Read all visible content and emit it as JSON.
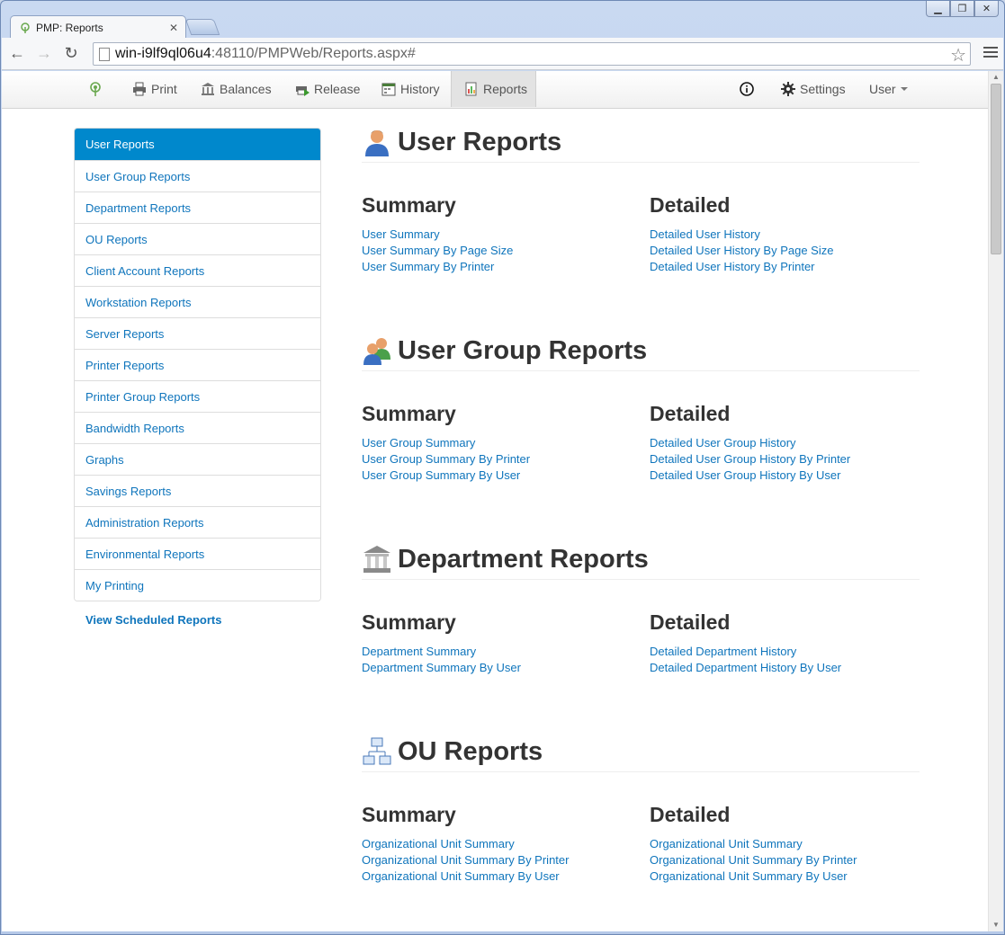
{
  "browser": {
    "tab_title": "PMP: Reports",
    "url_host": "win-i9lf9ql06u4",
    "url_path": ":48110/PMPWeb/Reports.aspx#"
  },
  "appnav": {
    "print": "Print",
    "balances": "Balances",
    "release": "Release",
    "history": "History",
    "reports": "Reports",
    "settings": "Settings",
    "user": "User"
  },
  "sidebar": {
    "items": [
      "User Reports",
      "User Group Reports",
      "Department Reports",
      "OU Reports",
      "Client Account Reports",
      "Workstation Reports",
      "Server Reports",
      "Printer Reports",
      "Printer Group Reports",
      "Bandwidth Reports",
      "Graphs",
      "Savings Reports",
      "Administration Reports",
      "Environmental Reports",
      "My Printing"
    ],
    "scheduled_link": "View Scheduled Reports"
  },
  "sections": [
    {
      "title": "User Reports",
      "icon": "user-icon",
      "summary_label": "Summary",
      "detailed_label": "Detailed",
      "summary": [
        "User Summary",
        "User Summary By Page Size",
        "User Summary By Printer"
      ],
      "detailed": [
        "Detailed User History",
        "Detailed User History By Page Size",
        "Detailed User History By Printer"
      ]
    },
    {
      "title": "User Group Reports",
      "icon": "user-group-icon",
      "summary_label": "Summary",
      "detailed_label": "Detailed",
      "summary": [
        "User Group Summary",
        "User Group Summary By Printer",
        "User Group Summary By User"
      ],
      "detailed": [
        "Detailed User Group History",
        "Detailed User Group History By Printer",
        "Detailed User Group History By User"
      ]
    },
    {
      "title": "Department Reports",
      "icon": "department-icon",
      "summary_label": "Summary",
      "detailed_label": "Detailed",
      "summary": [
        "Department Summary",
        "Department Summary By User"
      ],
      "detailed": [
        "Detailed Department History",
        "Detailed Department History By User"
      ]
    },
    {
      "title": "OU Reports",
      "icon": "org-chart-icon",
      "summary_label": "Summary",
      "detailed_label": "Detailed",
      "summary": [
        "Organizational Unit Summary",
        "Organizational Unit Summary By Printer",
        "Organizational Unit Summary By User"
      ],
      "detailed": [
        "Organizational Unit Summary",
        "Organizational Unit Summary By Printer",
        "Organizational Unit Summary By User"
      ]
    }
  ],
  "colors": {
    "link": "#0f75bc",
    "active_sidebar": "#0088cc"
  }
}
